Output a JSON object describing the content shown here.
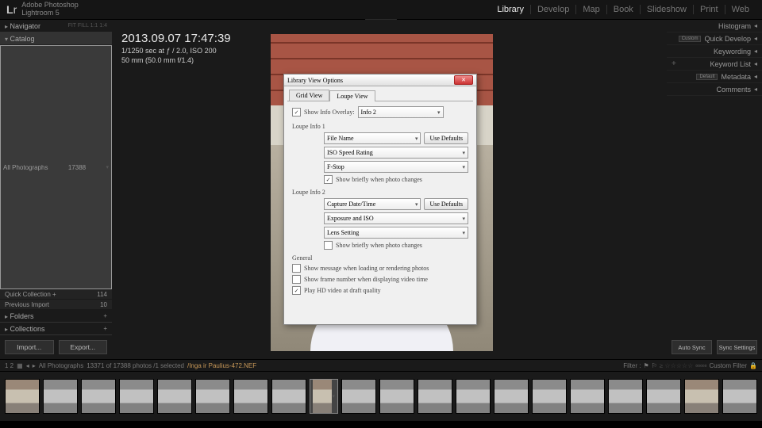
{
  "app": {
    "brand_prefix": "L",
    "brand_suffix": "r",
    "title_line1": "Adobe Photoshop",
    "title_line2": "Lightroom 5"
  },
  "modules": [
    "Library",
    "Develop",
    "Map",
    "Book",
    "Slideshow",
    "Print",
    "Web"
  ],
  "active_module": "Library",
  "nav": {
    "label": "Navigator",
    "zoom": "FIT  FILL  1:1  1:4"
  },
  "catalog": {
    "label": "Catalog",
    "items": [
      {
        "name": "All Photographs",
        "count": "17388"
      },
      {
        "name": "Quick Collection  +",
        "count": "114"
      },
      {
        "name": "Previous Import",
        "count": "10"
      }
    ]
  },
  "folders_label": "Folders",
  "collections_label": "Collections",
  "import_label": "Import...",
  "export_label": "Export...",
  "overlay": {
    "line1": "2013.09.07 17:47:39",
    "line2": "1/1250 sec at ƒ / 2.0, ISO 200",
    "line3": "50 mm (50.0 mm f/1.4)"
  },
  "dialog": {
    "title": "Library View Options",
    "tabs": [
      "Grid View",
      "Loupe View"
    ],
    "active_tab": "Loupe View",
    "show_info_overlay": "Show Info Overlay:",
    "overlay_sel": "Info 2",
    "group1": "Loupe Info 1",
    "g1_r1": "File Name",
    "g1_r2": "ISO Speed Rating",
    "g1_r3": "F-Stop",
    "g1_cb": "Show briefly when photo changes",
    "group2": "Loupe Info 2",
    "g2_r1": "Capture Date/Time",
    "g2_r2": "Exposure and ISO",
    "g2_r3": "Lens Setting",
    "g2_cb": "Show briefly when photo changes",
    "general": "General",
    "gen1": "Show message when loading or rendering photos",
    "gen2": "Show frame number when displaying video time",
    "gen3": "Play HD video at draft quality",
    "use_defaults": "Use Defaults"
  },
  "right_panel": {
    "histogram": "Histogram",
    "quick_develop": "Quick Develop",
    "custom": "Custom",
    "keywording": "Keywording",
    "keyword_list": "Keyword List",
    "metadata": "Metadata",
    "default": "Default",
    "comments": "Comments",
    "auto_sync": "Auto Sync",
    "sync_settings": "Sync Settings"
  },
  "filter_bar": {
    "nums": "1    2",
    "path": "All Photographs",
    "count": "13371 of 17388 photos /1 selected",
    "file": "/Inga ir Paulius-472.NEF",
    "filter_label": "Filter :",
    "custom_filter": "Custom Filter"
  }
}
